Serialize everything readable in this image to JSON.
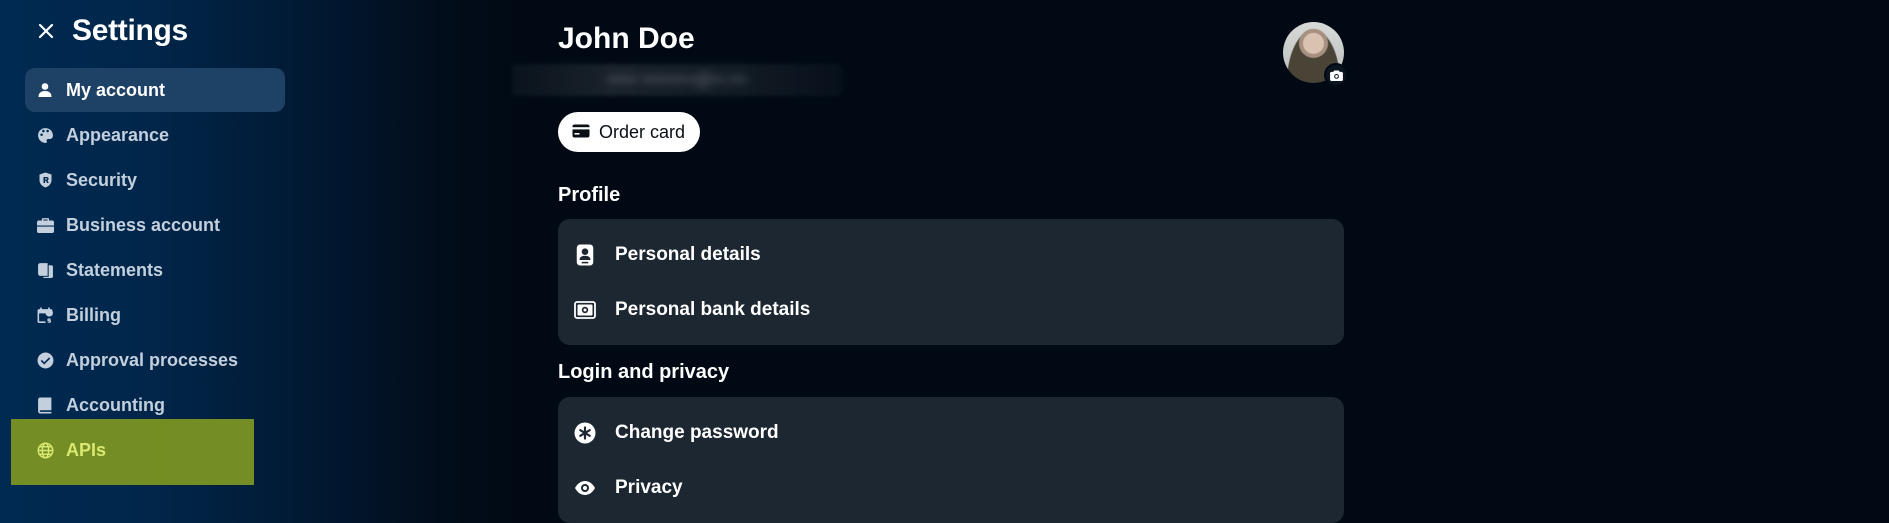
{
  "sidebar": {
    "title": "Settings",
    "items": [
      {
        "label": "My account",
        "icon": "person-icon"
      },
      {
        "label": "Appearance",
        "icon": "palette-icon"
      },
      {
        "label": "Security",
        "icon": "shield-icon"
      },
      {
        "label": "Business account",
        "icon": "briefcase-icon"
      },
      {
        "label": "Statements",
        "icon": "statements-icon"
      },
      {
        "label": "Billing",
        "icon": "calendar-billing-icon"
      },
      {
        "label": "Approval processes",
        "icon": "check-circle-icon"
      },
      {
        "label": "Accounting",
        "icon": "book-icon"
      },
      {
        "label": "APIs",
        "icon": "globe-icon"
      }
    ],
    "active_item": "My account"
  },
  "profile_header": {
    "name": "John Doe",
    "email_blurred": "••••• •••••••••@••.•••",
    "order_card_label": "Order card"
  },
  "profile_section": {
    "title": "Profile",
    "items": [
      {
        "label": "Personal details",
        "icon": "id-badge-icon"
      },
      {
        "label": "Personal bank details",
        "icon": "banknote-icon"
      }
    ]
  },
  "login_section": {
    "title": "Login and privacy",
    "items": [
      {
        "label": "Change password",
        "icon": "asterisk-icon"
      },
      {
        "label": "Privacy",
        "icon": "eye-icon"
      }
    ]
  },
  "colors": {
    "background": "#010a14",
    "sidebar_gradient": "#002a52",
    "active_item": "#1e4266",
    "card": "#1c2731",
    "highlight": "#7a9323",
    "highlight_text": "#d9e870"
  }
}
